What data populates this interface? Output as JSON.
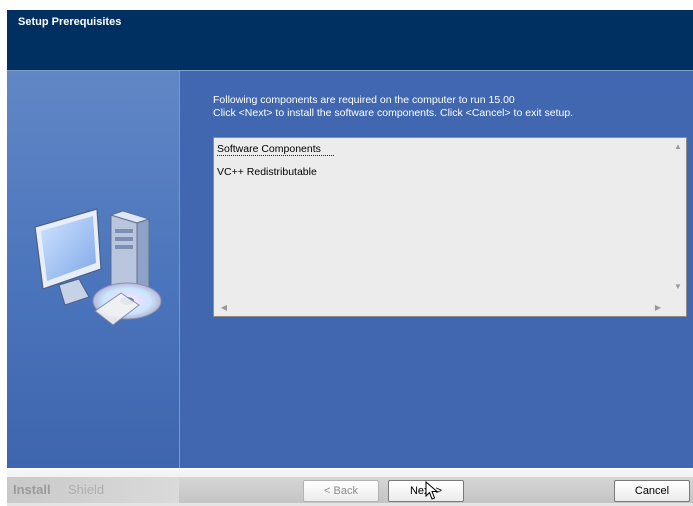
{
  "window": {
    "title": "Setup Prerequisites"
  },
  "intro": {
    "line1": "Following components are required on the computer to run 15.00",
    "line2": "Click <Next> to install the software components. Click <Cancel> to exit setup."
  },
  "components_list": {
    "header": "Software Components",
    "items": [
      "VC++ Redistributable"
    ]
  },
  "branding": {
    "bold": "Install",
    "light": "Shield"
  },
  "buttons": {
    "back": "< Back",
    "next": "Next >",
    "cancel": "Cancel"
  },
  "colors": {
    "header_bg": "#002f62",
    "panel_bg": "#4067b0",
    "listbox_bg": "#ececec"
  },
  "icons": {
    "illustration": "computer-with-cd-icon",
    "cursor": "mouse-pointer-icon"
  }
}
